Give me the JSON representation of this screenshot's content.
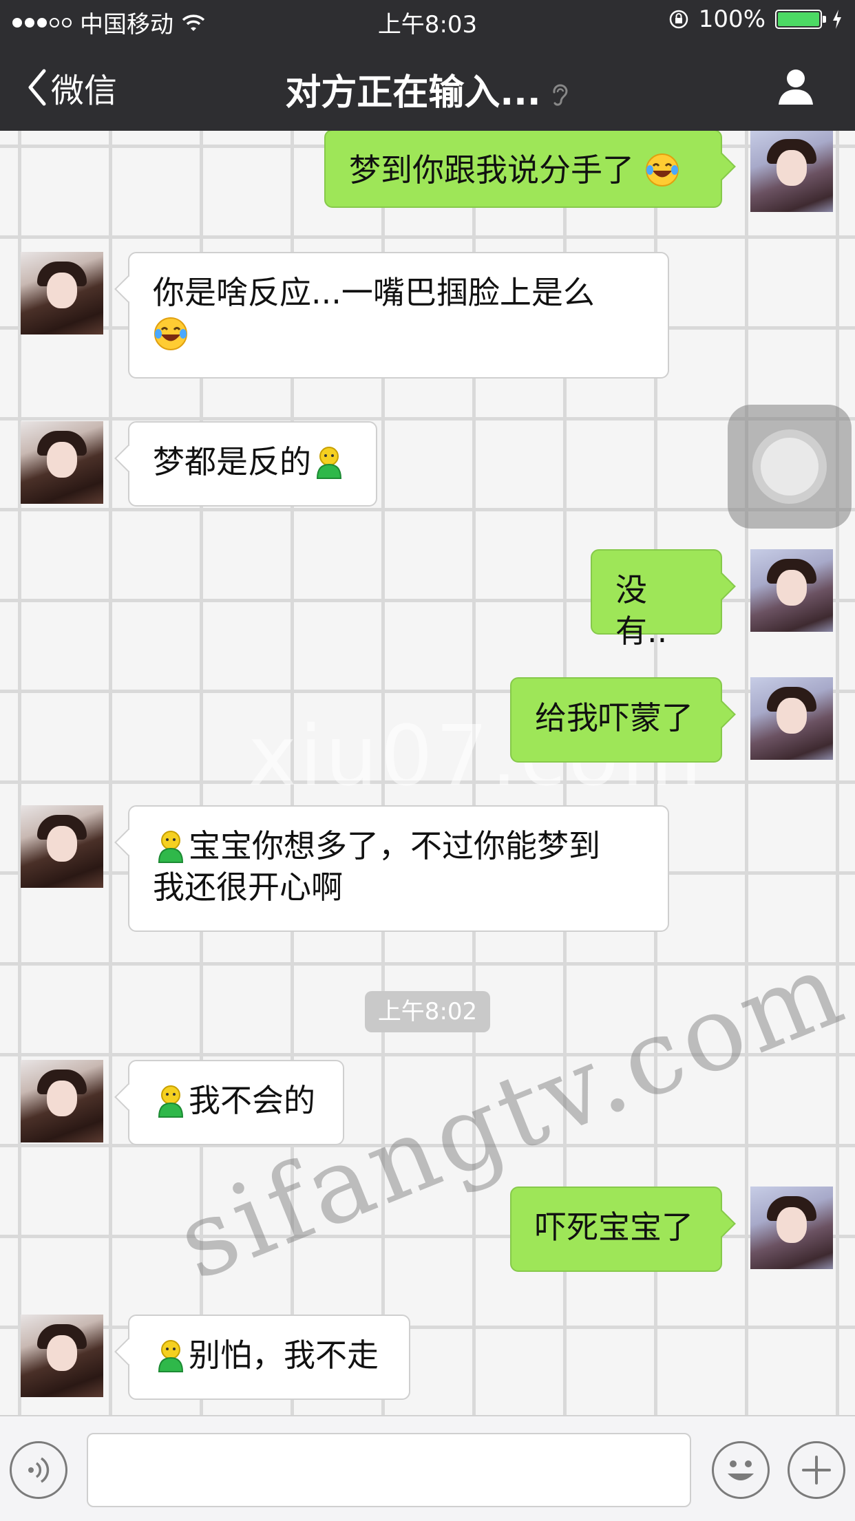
{
  "status_bar": {
    "carrier": "中国移动",
    "time": "上午8:03",
    "battery_percent": "100%",
    "battery_level": 1.0,
    "signal_bars_filled": 3,
    "signal_bars_total": 5,
    "icons": [
      "wifi-icon",
      "orientation-lock-icon",
      "battery-icon",
      "charging-icon"
    ]
  },
  "nav": {
    "back_label": "微信",
    "title": "对方正在输入...",
    "icons": [
      "back-chevron-icon",
      "ear-icon",
      "profile-icon"
    ]
  },
  "messages": [
    {
      "side": "right",
      "text": "梦到你跟我说分手了",
      "emoji_after": "laughing-tears-emoji"
    },
    {
      "side": "left",
      "text": "你是啥反应...一嘴巴掴脸上是么",
      "emoji_after": "laughing-tears-emoji"
    },
    {
      "side": "left",
      "text": "梦都是反的",
      "emoji_after": "green-figure-emoji"
    },
    {
      "side": "right",
      "text": "没有.."
    },
    {
      "side": "right",
      "text": "给我吓蒙了"
    },
    {
      "side": "left",
      "text_line1": "宝宝你想多了，不过你能梦到",
      "text_line2": "我还很开心啊",
      "emoji_before": "green-figure-emoji"
    },
    {
      "side": "left",
      "text": "我不会的",
      "emoji_before": "green-figure-emoji"
    },
    {
      "side": "right",
      "text": "吓死宝宝了"
    },
    {
      "side": "left",
      "text": "别怕，我不走",
      "emoji_before": "green-figure-emoji"
    }
  ],
  "timestamp": "上午8:02",
  "watermarks": {
    "top": "xiu07.com",
    "bottom": "sifangtv.com"
  },
  "input_bar": {
    "icons": [
      "voice-icon",
      "emoji-face-icon",
      "plus-icon"
    ]
  },
  "colors": {
    "nav_bg": "#2e2e31",
    "bubble_sent": "#9ee658",
    "bubble_received": "#ffffff",
    "battery_fill": "#4cd964"
  }
}
